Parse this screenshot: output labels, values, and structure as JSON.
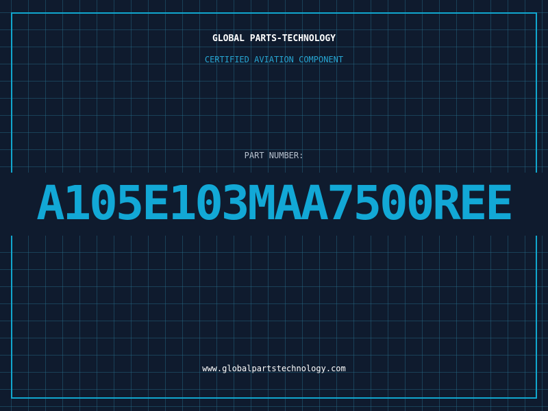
{
  "header": {
    "company_name": "GLOBAL PARTS-TECHNOLOGY",
    "tagline": "CERTIFIED AVIATION COMPONENT"
  },
  "part": {
    "label": "PART NUMBER:",
    "number": "A105E103MAA7500REE"
  },
  "footer": {
    "website": "www.globalpartstechnology.com"
  },
  "colors": {
    "background": "#0f1b2e",
    "accent": "#12a8d6",
    "grid": "#286e8c",
    "text_primary": "#ffffff",
    "text_secondary": "#b8c2cf"
  }
}
